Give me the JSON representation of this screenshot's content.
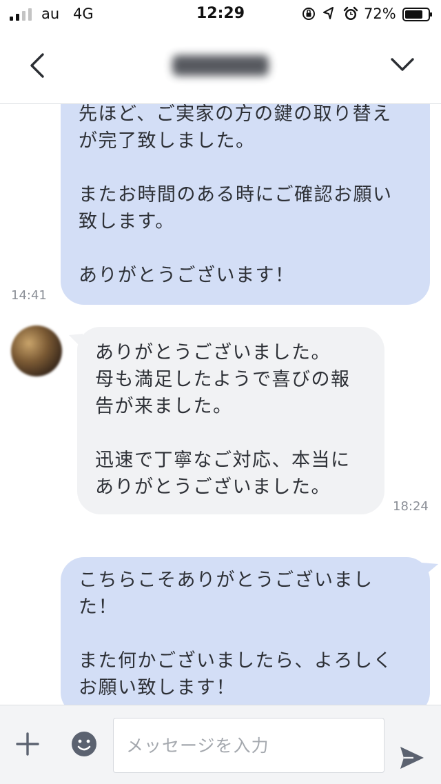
{
  "status_bar": {
    "carrier": "au",
    "network": "4G",
    "time": "12:29",
    "battery": "72%",
    "icons": [
      "signal-icon",
      "rotation-lock-icon",
      "location-icon",
      "alarm-icon",
      "battery-icon"
    ]
  },
  "header": {
    "back_icon": "chevron-left-icon",
    "menu_icon": "chevron-down-icon"
  },
  "messages": [
    {
      "direction": "sent",
      "text": "先ほど、ご実家の方の鍵の取り替え\nが完了致しました。\n\nまたお時間のある時にご確認お願い\n致します。\n\nありがとうございます！",
      "time": "14:41"
    },
    {
      "direction": "received",
      "text": "ありがとうございました。\n母も満足したようで喜びの報\n告が来ました。\n\n迅速で丁寧なご対応、本当に\nありがとうございました。",
      "time": "18:24"
    },
    {
      "direction": "sent",
      "text": "こちらこそありがとうございまし\nた！\n\nまた何かございましたら、よろしく\nお願い致します！"
    }
  ],
  "composer": {
    "placeholder": "メッセージを入力",
    "value": "",
    "add_icon": "plus-icon",
    "emoji_icon": "emoji-icon",
    "send_icon": "send-icon"
  },
  "colors": {
    "sent_bubble": "#d3def6",
    "received_bubble": "#f1f2f4",
    "timestamp": "#8a8e96",
    "icon": "#5b6270"
  }
}
